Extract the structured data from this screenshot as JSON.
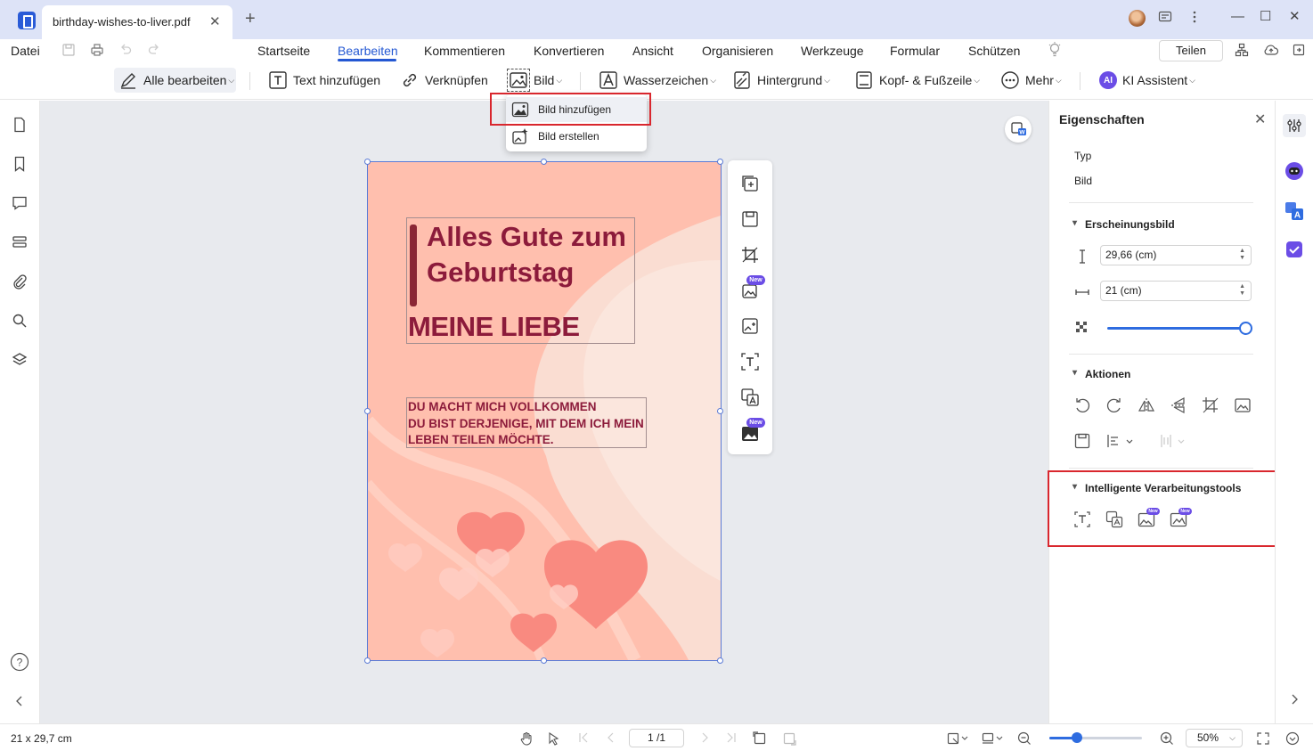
{
  "window": {
    "tab_title": "birthday-wishes-to-liver.pdf",
    "tab_close": "✕",
    "new_tab": "+",
    "minimize": "—",
    "maximize": "☐",
    "close": "✕"
  },
  "menu": {
    "file": "Datei",
    "tabs": [
      {
        "label": "Startseite",
        "active": false
      },
      {
        "label": "Bearbeiten",
        "active": true
      },
      {
        "label": "Kommentieren",
        "active": false
      },
      {
        "label": "Konvertieren",
        "active": false
      },
      {
        "label": "Ansicht",
        "active": false
      },
      {
        "label": "Organisieren",
        "active": false
      },
      {
        "label": "Werkzeuge",
        "active": false
      },
      {
        "label": "Formular",
        "active": false
      },
      {
        "label": "Schützen",
        "active": false
      }
    ],
    "share": "Teilen"
  },
  "toolbar": {
    "edit_all": "Alle bearbeiten",
    "add_text": "Text hinzufügen",
    "link": "Verknüpfen",
    "image": "Bild",
    "watermark": "Wasserzeichen",
    "background": "Hintergrund",
    "header_footer": "Kopf- & Fußzeile",
    "more": "Mehr",
    "ai_badge": "AI",
    "ai_assistant": "KI Assistent"
  },
  "image_menu": {
    "add_image": "Bild hinzufügen",
    "create_image": "Bild erstellen"
  },
  "document": {
    "title": "Alles Gute zum Geburtstag",
    "subtitle": "MEINE LIEBE",
    "message_lines": [
      "DU MACHT MICH VOLLKOMMEN",
      "DU BIST DERJENIGE, MIT DEM ICH MEIN",
      "LEBEN TEILEN MÖCHTE."
    ]
  },
  "float_tools": {
    "new_badge": "New"
  },
  "properties": {
    "title": "Eigenschaften",
    "close": "✕",
    "type_label": "Typ",
    "type_value": "Bild",
    "appearance": "Erscheinungsbild",
    "height_value": "29,66 (cm)",
    "width_value": "21 (cm)",
    "opacity_fraction": 1.0,
    "actions": "Aktionen",
    "smart_tools": "Intelligente Verarbeitungstools",
    "new_badge": "New"
  },
  "status": {
    "page_size": "21 x 29,7 cm",
    "page_indicator": "1 /1",
    "zoom": "50%",
    "zoom_fraction": 0.3
  },
  "colors": {
    "accent": "#2458d3",
    "highlight_red": "#d9272e",
    "card_bg": "#ffbfae",
    "card_text": "#8c1b3b",
    "heart": "#f98a80",
    "new_badge": "#6b4de6"
  }
}
